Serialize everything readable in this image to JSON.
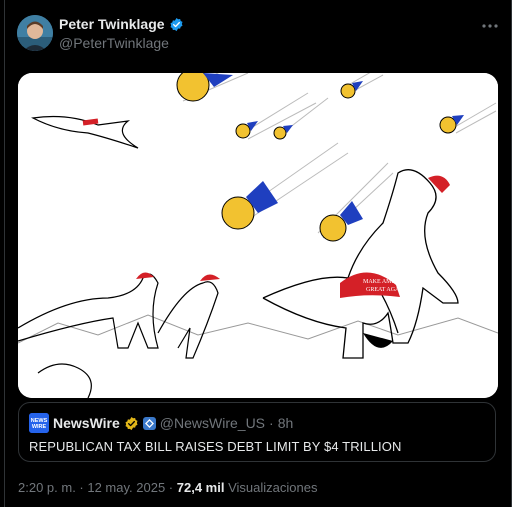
{
  "author": {
    "display_name": "Peter Twinklage",
    "handle": "@PeterTwinklage",
    "verified": true,
    "verified_color": "#1d9bf0"
  },
  "icons": {
    "more": "more-horizontal-icon",
    "verified": "verified-badge-icon"
  },
  "media": {
    "hat_text_line1": "MAKE AMERICA",
    "hat_text_line2": "GREAT AGAIN",
    "hat_color": "#d42027",
    "ribbon_color": "#1f3fbf",
    "medal_color": "#f2c230"
  },
  "quoted_post": {
    "source_name": "NewsWire",
    "logo_text_1": "NEWS",
    "logo_text_2": "WIRE",
    "handle": "@NewsWire_US",
    "separator": "·",
    "time": "8h",
    "text": "REPUBLICAN TAX BILL RAISES DEBT LIMIT BY $4 TRILLION",
    "verified_color": "#e2b719"
  },
  "meta": {
    "timestamp": "2:20 p. m. · 12 may. 2025 ·",
    "views_count": "72,4 mil",
    "views_label": "Visualizaciones"
  }
}
